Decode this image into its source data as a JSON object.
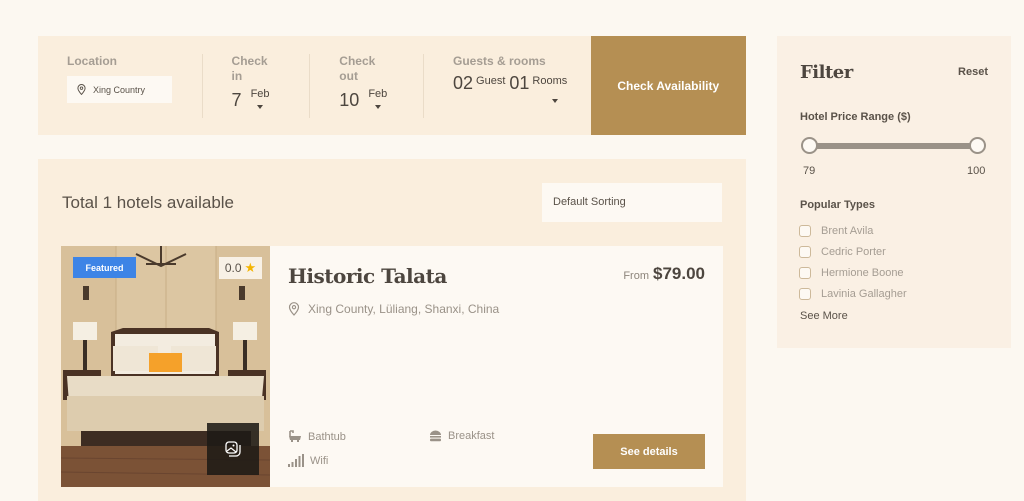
{
  "search": {
    "location_label": "Location",
    "location_value": "Xing Country",
    "checkin_label": "Check in",
    "checkin_day": "7",
    "checkin_month": "Feb",
    "checkout_label": "Check out",
    "checkout_day": "10",
    "checkout_month": "Feb",
    "guests_label": "Guests & rooms",
    "guests_count": "02",
    "guests_unit": "Guest",
    "rooms_count": "01",
    "rooms_unit": "Rooms",
    "check_button": "Check Availability"
  },
  "results": {
    "total_text": "Total 1 hotels available",
    "sort_selected": "Default Sorting",
    "hotels": [
      {
        "badge": "Featured",
        "rating": "0.0",
        "name": "Historic Talata",
        "price_prefix": "From",
        "price": "$79.00",
        "address": "Xing County, Lüliang, Shanxi, China",
        "amenities": [
          {
            "icon": "bathtub-icon",
            "label": "Bathtub"
          },
          {
            "icon": "burger-icon",
            "label": "Breakfast"
          },
          {
            "icon": "wifi-signal-icon",
            "label": "Wifi"
          }
        ],
        "details_button": "See details"
      }
    ]
  },
  "filter": {
    "title": "Filter",
    "reset": "Reset",
    "price_range_label": "Hotel Price Range ($)",
    "price_min": "79",
    "price_max": "100",
    "popular_types_label": "Popular Types",
    "types": [
      "Brent Avila",
      "Cedric Porter",
      "Hermione Boone",
      "Lavinia Gallagher"
    ],
    "see_more": "See More"
  },
  "colors": {
    "accent": "#b58f53",
    "panel": "#faeedd",
    "featured_badge": "#3d84e6",
    "star": "#f4b400"
  }
}
